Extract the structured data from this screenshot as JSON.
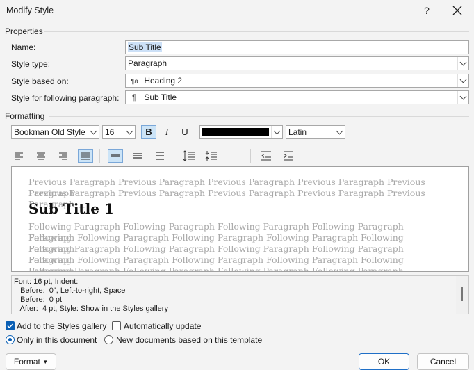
{
  "window": {
    "title": "Modify Style",
    "help_label": "?"
  },
  "properties": {
    "section_label": "Properties",
    "name_label": "Name:",
    "name_value": "Sub Title",
    "style_type_label": "Style type:",
    "style_type_value": "Paragraph",
    "based_on_label": "Style based on:",
    "based_on_value": "Heading 2",
    "following_label": "Style for following paragraph:",
    "following_value": "Sub Title"
  },
  "formatting": {
    "section_label": "Formatting",
    "font_name": "Bookman Old Style",
    "font_size": "16",
    "bold_label": "B",
    "italic_label": "I",
    "underline_label": "U",
    "font_color": "#000000",
    "script": "Latin"
  },
  "preview": {
    "previous_text_1": "Previous Paragraph Previous Paragraph Previous Paragraph Previous Paragraph Previous Paragraph",
    "previous_text_2": "Previous Paragraph Previous Paragraph Previous Paragraph Previous Paragraph Previous Paragraph",
    "heading": "Sub Title 1",
    "following_lines": [
      "Following Paragraph Following Paragraph Following Paragraph Following Paragraph Following",
      "Paragraph Following Paragraph Following Paragraph Following Paragraph Following Paragraph",
      "Following Paragraph Following Paragraph Following Paragraph Following Paragraph Following",
      "Paragraph Following Paragraph Following Paragraph Following Paragraph Following Paragraph",
      "Following Paragraph Following Paragraph Following Paragraph Following Paragraph Following"
    ]
  },
  "description": {
    "lines": [
      "Font: 16 pt, Indent:",
      "   Before:  0\", Left-to-right, Space",
      "   Before:  0 pt",
      "   After:  4 pt, Style: Show in the Styles gallery"
    ]
  },
  "options": {
    "add_to_gallery": "Add to the Styles gallery",
    "auto_update": "Automatically update",
    "only_this_doc": "Only in this document",
    "new_docs": "New documents based on this template"
  },
  "buttons": {
    "format": "Format",
    "ok": "OK",
    "cancel": "Cancel"
  },
  "colors": {
    "accent": "#0a5fb4",
    "selection": "#cce0f7"
  }
}
